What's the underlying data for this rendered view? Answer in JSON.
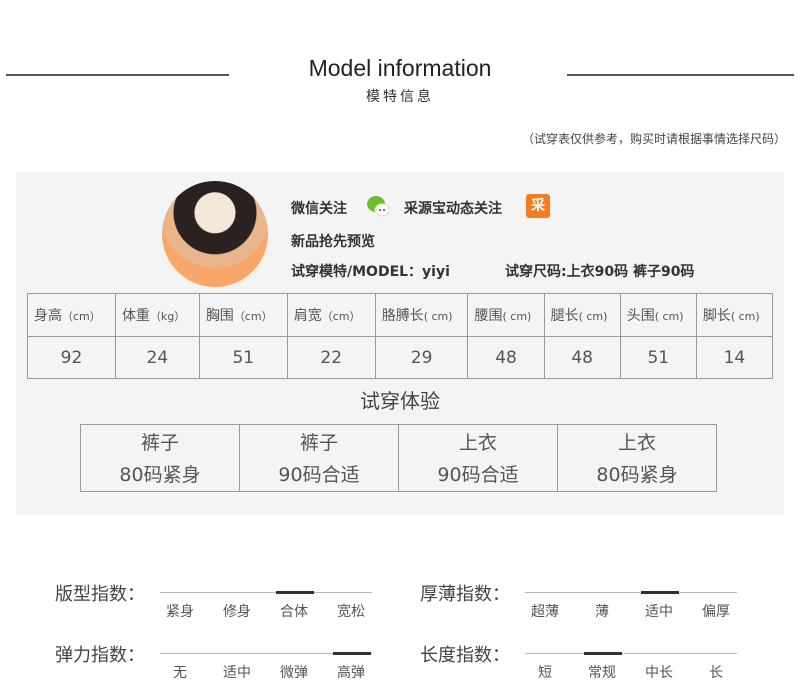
{
  "header": {
    "title": "Model information",
    "subtitle": "模特信息",
    "note": "（试穿表仅供参考，购买时请根据事情选择尺码）"
  },
  "profile": {
    "wechat": "微信关注",
    "caiyuanbao": "采源宝动态关注",
    "caiyuanbao_icon_char": "采",
    "preview": "新品抢先预览",
    "model": "试穿模特/MODEL：yiyi",
    "size": "试穿尺码:上衣90码 裤子90码",
    "icons": [
      "wechat-icon",
      "caiyuanbao-icon"
    ],
    "accent": "#f47c20"
  },
  "measurements": {
    "headers": [
      {
        "name": "身高",
        "unit": "（cm）"
      },
      {
        "name": "体重",
        "unit": "（kg）"
      },
      {
        "name": "胸围",
        "unit": "（cm）"
      },
      {
        "name": "肩宽",
        "unit": "（cm）"
      },
      {
        "name": "胳膊长",
        "unit": "( cm)"
      },
      {
        "name": "腰围",
        "unit": "( cm)"
      },
      {
        "name": "腿长",
        "unit": "( cm)"
      },
      {
        "name": "头围",
        "unit": "( cm)"
      },
      {
        "name": "脚长",
        "unit": "( cm)"
      }
    ],
    "values": [
      "92",
      "24",
      "51",
      "22",
      "29",
      "48",
      "48",
      "51",
      "14"
    ]
  },
  "fitting": {
    "title": "试穿体验",
    "items": [
      {
        "item": "裤子",
        "result": "80码紧身"
      },
      {
        "item": "裤子",
        "result": "90码合适"
      },
      {
        "item": "上衣",
        "result": "90码合适"
      },
      {
        "item": "上衣",
        "result": "80码紧身"
      }
    ]
  },
  "indices": [
    {
      "label": "版型指数：",
      "options": [
        "紧身",
        "修身",
        "合体",
        "宽松"
      ],
      "selected": 2
    },
    {
      "label": "厚薄指数：",
      "options": [
        "超薄",
        "薄",
        "适中",
        "偏厚"
      ],
      "selected": 2
    },
    {
      "label": "弹力指数：",
      "options": [
        "无",
        "适中",
        "微弹",
        "高弹"
      ],
      "selected": 3
    },
    {
      "label": "长度指数：",
      "options": [
        "短",
        "常规",
        "中长",
        "长"
      ],
      "selected": 1
    }
  ]
}
